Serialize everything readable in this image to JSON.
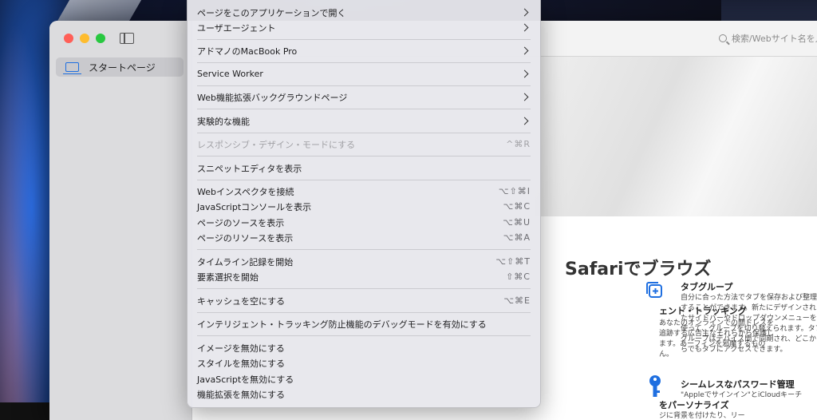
{
  "sidebar": {
    "start_page": "スタートページ"
  },
  "toolbar": {
    "search_placeholder": "検索/Webサイト名を入力"
  },
  "content": {
    "title": "Safariでブラウズ",
    "left_feature_title": "ェント・トラッキング",
    "left_feature_text": "あなたのオンラインでの閲ドレスを追跡する広告主なそれらから保護します。あーフィンを邪魔するものん。",
    "left_feature_title2": "をパーソナライズ",
    "left_feature_text2": "ジに背景を付けたり、リー",
    "tab_group_title": "タブグループ",
    "tab_group_text": "自分に合った方法でタブを保存および整理することができます。新たにデザインされたサイドバーやドロップダウンメニューを使って、グループを切り替えられます。タブグループはデバイス間で同期され、どこからでもタブにアクセスできます。",
    "password_title": "シームレスなパスワード管理",
    "password_text": "\"Appleでサインイン\"とiCloudキーチ"
  },
  "menu": {
    "items": [
      {
        "label": "ページをこのアプリケーションで開く",
        "submenu": true
      },
      {
        "label": "ユーザエージェント",
        "submenu": true
      },
      {
        "label": "アドマノのMacBook Pro",
        "submenu": true
      },
      {
        "label": "Service Worker",
        "submenu": true
      },
      {
        "label": "Web機能拡張バックグラウンドページ",
        "submenu": true
      },
      {
        "label": "実験的な機能",
        "submenu": true
      },
      {
        "label": "レスポンシブ・デザイン・モードにする",
        "shortcut": "^⌘R",
        "disabled": true
      },
      {
        "label": "スニペットエディタを表示"
      },
      {
        "label": "Webインスペクタを接続",
        "shortcut": "⌥⇧⌘I"
      },
      {
        "label": "JavaScriptコンソールを表示",
        "shortcut": "⌥⌘C"
      },
      {
        "label": "ページのソースを表示",
        "shortcut": "⌥⌘U"
      },
      {
        "label": "ページのリソースを表示",
        "shortcut": "⌥⌘A"
      },
      {
        "label": "タイムライン記録を開始",
        "shortcut": "⌥⇧⌘T"
      },
      {
        "label": "要素選択を開始",
        "shortcut": "⇧⌘C"
      },
      {
        "label": "キャッシュを空にする",
        "shortcut": "⌥⌘E"
      },
      {
        "label": "インテリジェント・トラッキング防止機能のデバッグモードを有効にする"
      },
      {
        "label": "イメージを無効にする"
      },
      {
        "label": "スタイルを無効にする"
      },
      {
        "label": "JavaScriptを無効にする"
      },
      {
        "label": "機能拡張を無効にする"
      }
    ]
  }
}
